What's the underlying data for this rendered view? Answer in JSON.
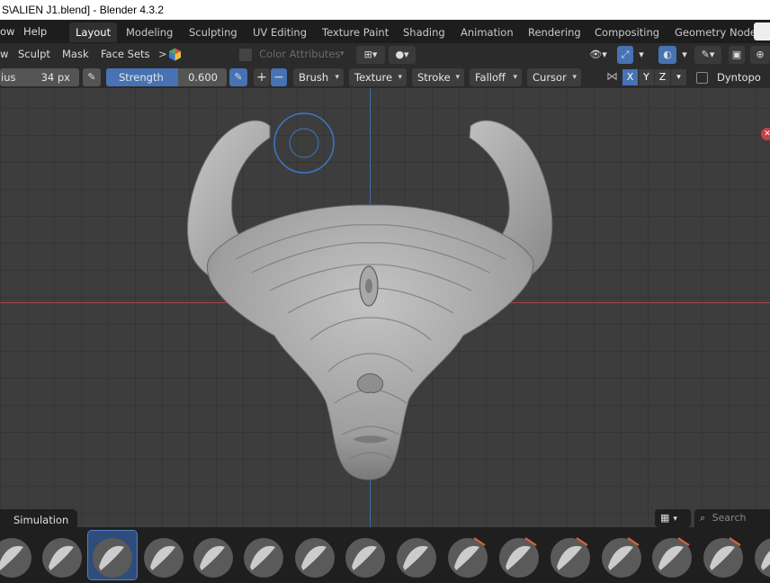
{
  "window": {
    "title": "S\\ALIEN J1.blend] - Blender 4.3.2"
  },
  "menu": {
    "items": [
      "ow",
      "Help"
    ]
  },
  "workspaces": [
    "Layout",
    "Modeling",
    "Sculpting",
    "UV Editing",
    "Texture Paint",
    "Shading",
    "Animation",
    "Rendering",
    "Compositing",
    "Geometry Node"
  ],
  "active_workspace": "Layout",
  "modebar": {
    "items": [
      "w",
      "Sculpt",
      "Mask",
      "Face Sets"
    ],
    "color_attributes": "Color Attributes"
  },
  "toolbar": {
    "radius_label": "ius",
    "radius_value": "34 px",
    "strength_label": "Strength",
    "strength_value": "0.600",
    "strength_fraction": 0.6,
    "plus": "+",
    "minus": "−",
    "brush": "Brush",
    "texture": "Texture",
    "stroke": "Stroke",
    "falloff": "Falloff",
    "cursor": "Cursor",
    "axis_x": "X",
    "axis_y": "Y",
    "axis_z": "Z",
    "dyntopo": "Dyntopo"
  },
  "shelf": {
    "tab": "Simulation",
    "search_placeholder": "Search",
    "brushes": [
      "blob",
      "smooth",
      "draw-active",
      "clay-strips",
      "crease",
      "pinch",
      "flatten",
      "snake-hook",
      "scrape",
      "fill",
      "mask",
      "draw-face-sets",
      "elastic-deform",
      "cloth",
      "pose",
      "rotate"
    ]
  },
  "colors": {
    "accent": "#4772b3",
    "axis_x": "#c9403f",
    "axis_y": "#3b6fb5"
  }
}
